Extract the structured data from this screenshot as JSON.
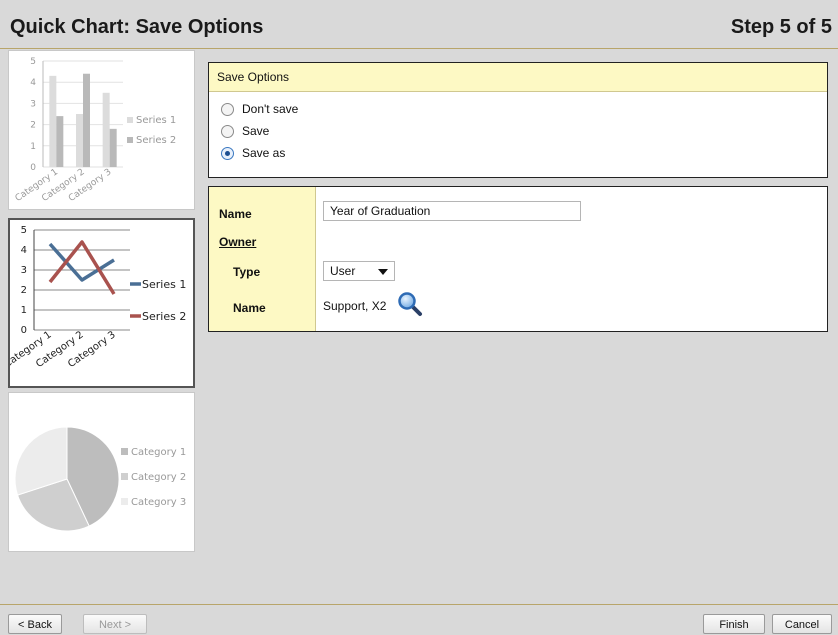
{
  "header": {
    "title": "Quick Chart: Save Options",
    "step": "Step 5 of 5"
  },
  "thumbnails": [
    {
      "chart_data": {
        "type": "bar",
        "categories": [
          "Category 1",
          "Category 2",
          "Category 3"
        ],
        "series": [
          {
            "name": "Series 1",
            "values": [
              4.3,
              2.5,
              3.5
            ]
          },
          {
            "name": "Series 2",
            "values": [
              2.4,
              4.4,
              1.8
            ]
          }
        ],
        "ylim": [
          0,
          5
        ],
        "yticks": [
          "0",
          "1",
          "2",
          "3",
          "4",
          "5"
        ],
        "colors": [
          "#dcdcdc",
          "#b9b9b9"
        ],
        "legend": "right"
      }
    },
    {
      "chart_data": {
        "type": "line",
        "categories": [
          "Category 1",
          "Category 2",
          "Category 3"
        ],
        "series": [
          {
            "name": "Series 1",
            "values": [
              4.3,
              2.5,
              3.5
            ]
          },
          {
            "name": "Series 2",
            "values": [
              2.4,
              4.4,
              1.8
            ]
          }
        ],
        "ylim": [
          0,
          5
        ],
        "yticks": [
          "0",
          "1",
          "2",
          "3",
          "4",
          "5"
        ],
        "colors": [
          "#4a6f95",
          "#a9524e"
        ],
        "legend": "right",
        "selected": true
      }
    },
    {
      "chart_data": {
        "type": "pie",
        "categories": [
          "Category 1",
          "Category 2",
          "Category 3"
        ],
        "values": [
          43,
          27,
          30
        ],
        "colors": [
          "#bdbdbd",
          "#cfcfcf",
          "#ececec"
        ],
        "legend": "right"
      }
    }
  ],
  "save_options": {
    "title": "Save Options",
    "options": [
      {
        "label": "Don't save",
        "checked": false
      },
      {
        "label": "Save",
        "checked": false
      },
      {
        "label": "Save as",
        "checked": true
      }
    ]
  },
  "form": {
    "name_label": "Name",
    "name_value": "Year of Graduation",
    "owner_label": "Owner",
    "type_label": "Type",
    "type_value": "User",
    "owner_name_label": "Name",
    "owner_name_value": "Support, X2",
    "lookup_icon": "magnifier-icon"
  },
  "footer": {
    "back_label": "< Back",
    "next_label": "Next >",
    "finish_label": "Finish",
    "cancel_label": "Cancel"
  }
}
